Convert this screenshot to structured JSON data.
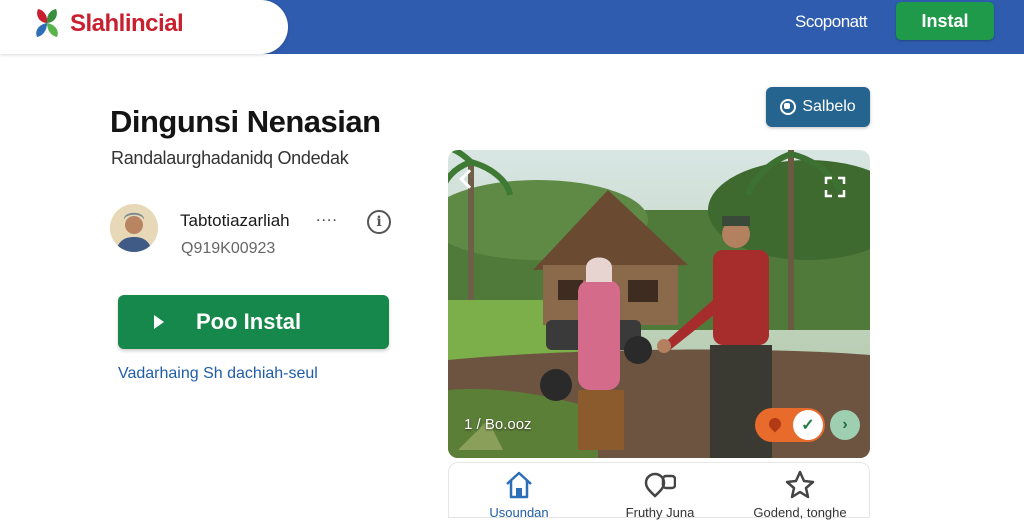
{
  "header": {
    "brand": "Slahlincial",
    "link": "Scoponatt",
    "install_button": "Instal"
  },
  "main": {
    "title": "Dingunsi Nenasian",
    "subtitle": "Randalaurghadanidq Ondedak",
    "author": {
      "name": "Tabtotiazarliah",
      "dots": "....",
      "id": "Q919K00923"
    },
    "install_button": "Poo Instal",
    "link": "Vadarhaing Sh dachiah-seul"
  },
  "save_button": "Salbelo",
  "photo": {
    "counter": "1 / Bo.ooz"
  },
  "bottom_nav": [
    {
      "label": "Usoundan",
      "icon": "home-icon"
    },
    {
      "label": "Fruthy Juna",
      "icon": "chat-icon"
    },
    {
      "label": "Godend, tonghe",
      "icon": "star-icon"
    }
  ],
  "colors": {
    "topbar": "#2f5cae",
    "brand": "#c8202f",
    "install_green": "#16884b",
    "link_blue": "#1f5da8",
    "save_button": "#25648f"
  }
}
